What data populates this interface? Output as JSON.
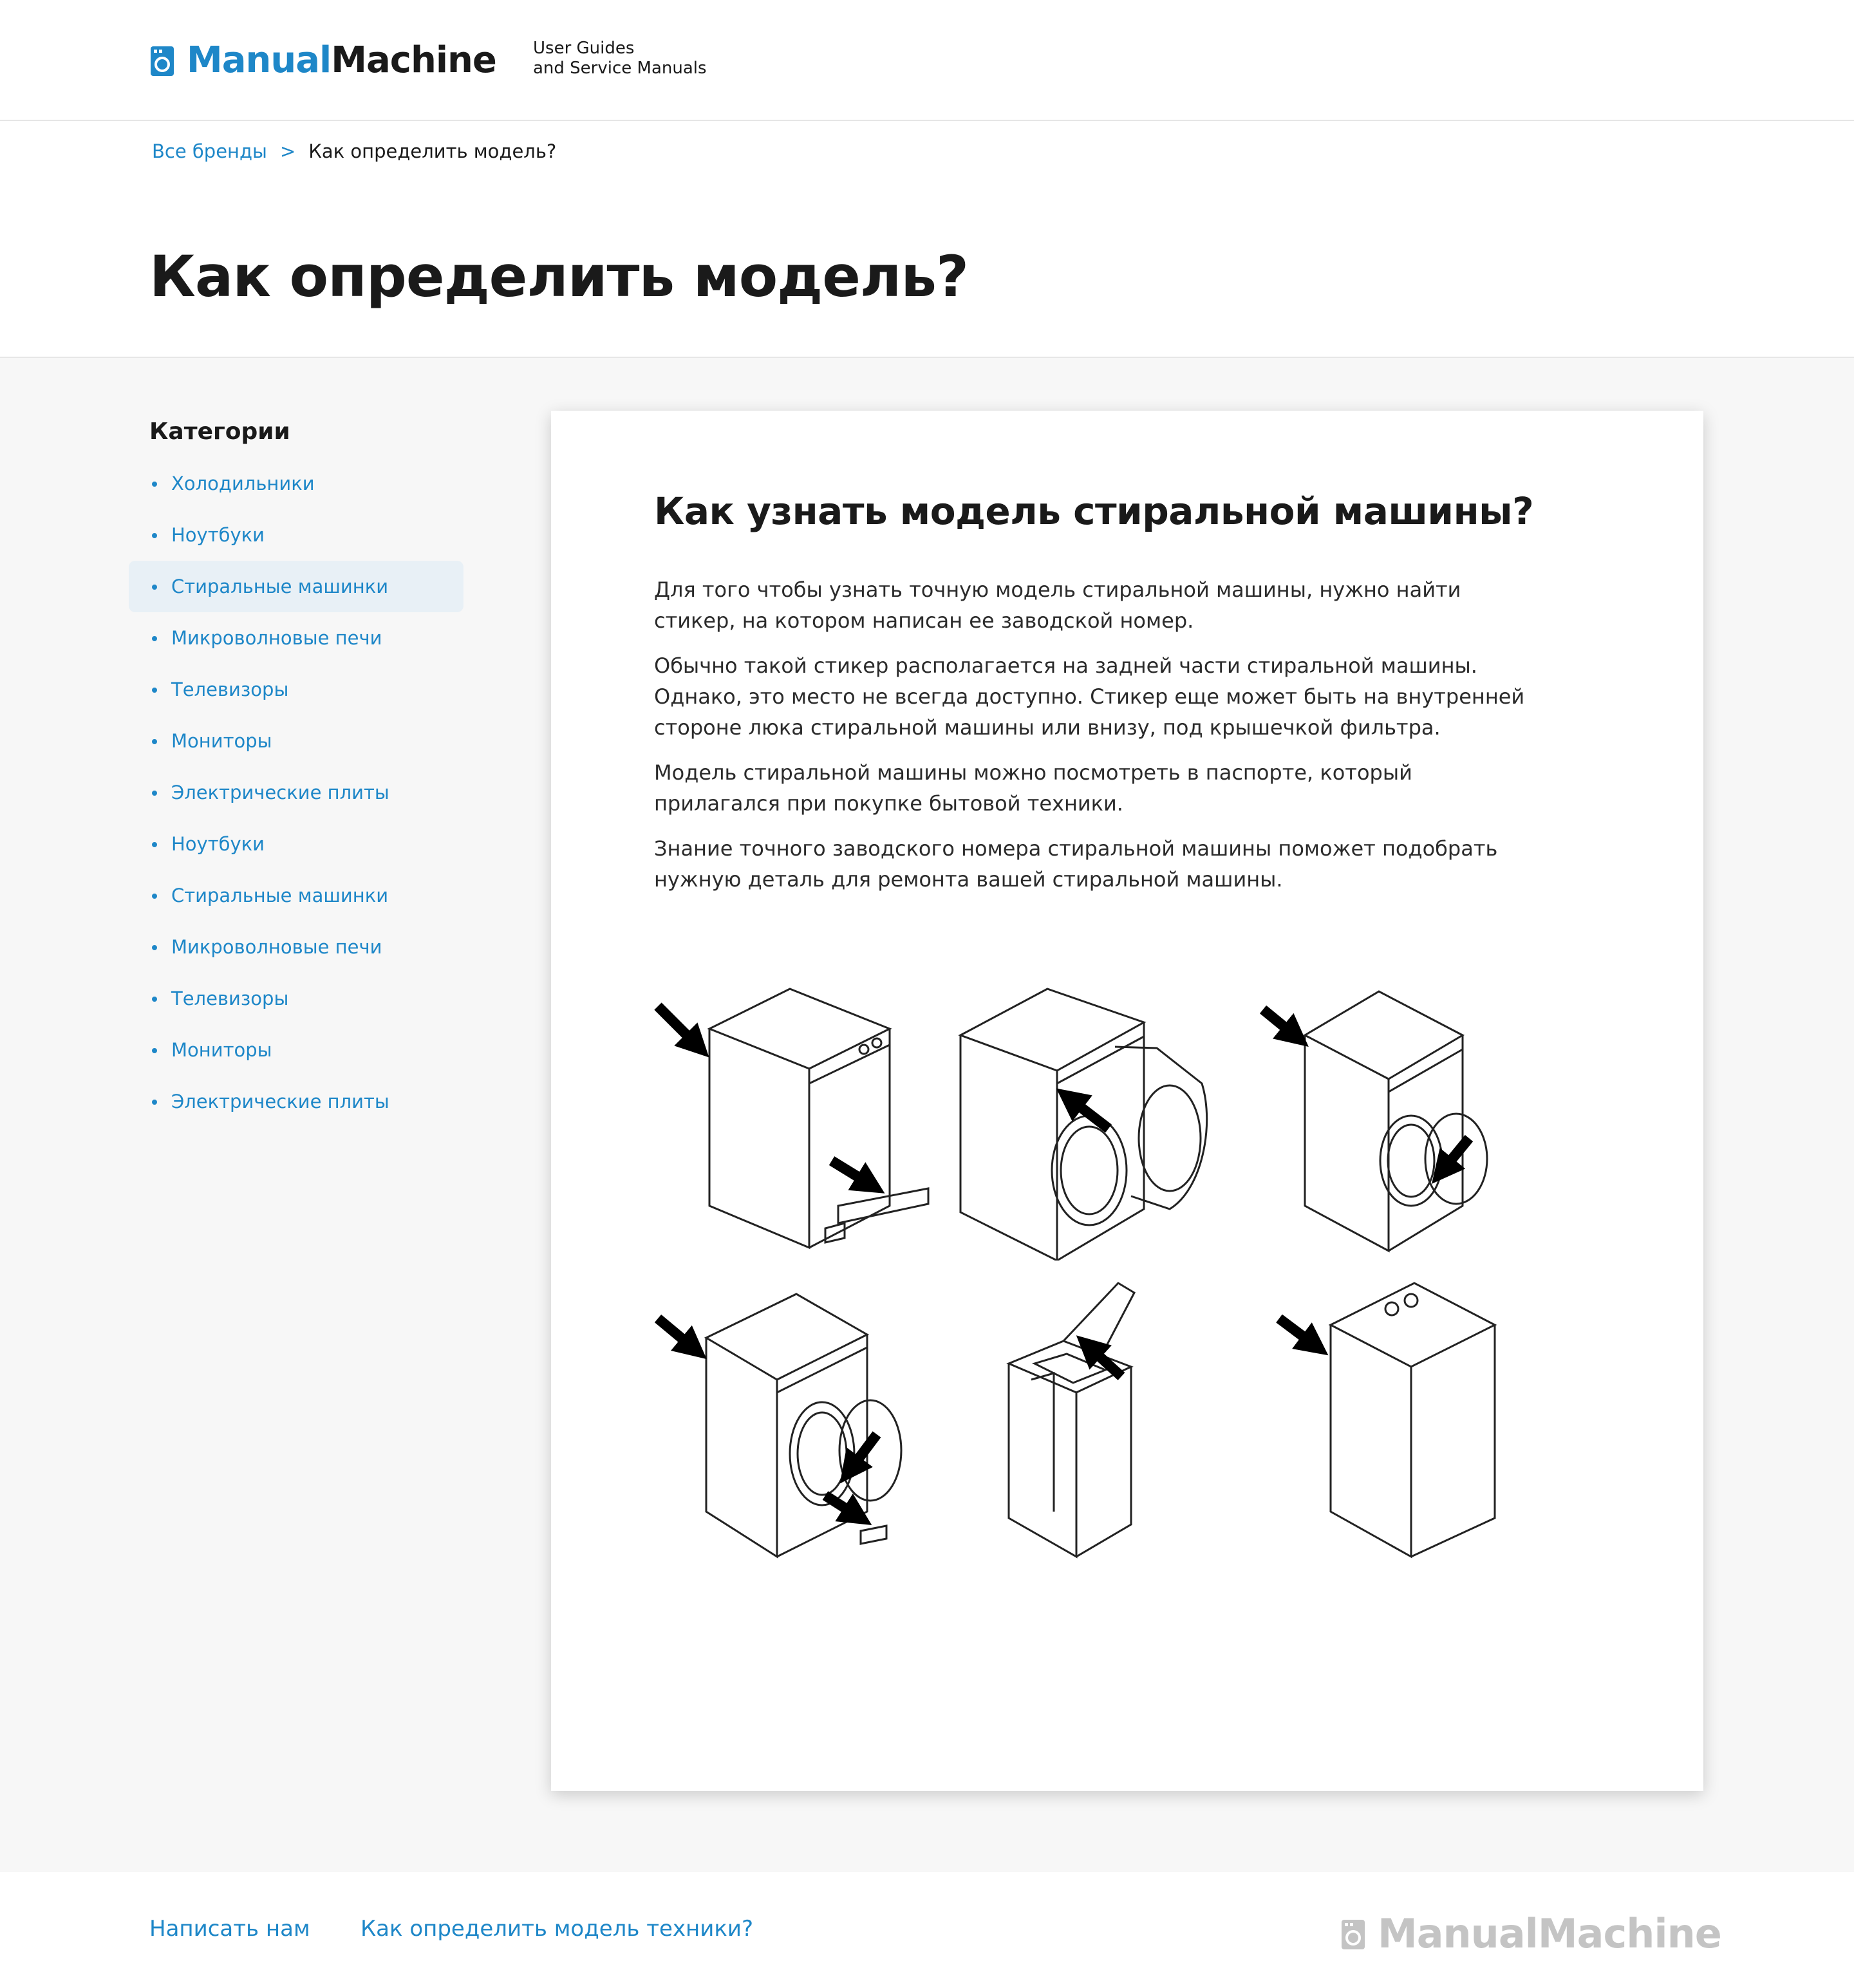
{
  "header": {
    "logo_part1": "Manual",
    "logo_part2": "Machine",
    "tagline_line1": "User Guides",
    "tagline_line2": "and Service Manuals"
  },
  "breadcrumb": {
    "home": "Все бренды",
    "separator": ">",
    "current": "Как определить модель?"
  },
  "page_title": "Как определить модель?",
  "sidebar": {
    "title": "Категории",
    "items": [
      {
        "label": "Холодильники"
      },
      {
        "label": "Ноутбуки"
      },
      {
        "label": "Стиральные машинки",
        "active": true
      },
      {
        "label": "Микроволновые печи"
      },
      {
        "label": "Телевизоры"
      },
      {
        "label": "Мониторы"
      },
      {
        "label": "Электрические плиты"
      },
      {
        "label": "Ноутбуки"
      },
      {
        "label": "Стиральные машинки"
      },
      {
        "label": "Микроволновые печи"
      },
      {
        "label": "Телевизоры"
      },
      {
        "label": "Мониторы"
      },
      {
        "label": "Электрические плиты"
      }
    ]
  },
  "article": {
    "title": "Как узнать модель стиральной машины?",
    "paragraphs": [
      "Для того чтобы узнать точную модель стиральной машины, нужно найти стикер, на котором написан ее заводской номер.",
      "Обычно такой стикер располагается на задней части стиральной машины. Однако, это место не всегда доступно. Стикер еще может быть на внутренней стороне люка стиральной машины или внизу, под крышечкой фильтра.",
      "Модель стиральной машины можно посмотреть в паспорте, который прилагался при покупке бытовой техники.",
      "Знание точного заводского номера стиральной машины поможет подобрать нужную деталь для ремонта вашей стиральной машины."
    ]
  },
  "footer": {
    "link_contact": "Написать нам",
    "link_howto": "Как определить модель техники?",
    "logo_part1": "Manual",
    "logo_part2": "Machine"
  },
  "colors": {
    "accent": "#1e87c8",
    "text": "#1a1a1a",
    "background_main": "#f7f7f7",
    "active_item_bg": "#e8f0f6",
    "footer_logo": "#c4c4c4"
  },
  "icons": [
    "washing-machine-logo-icon",
    "arrow-indicator-icon"
  ]
}
